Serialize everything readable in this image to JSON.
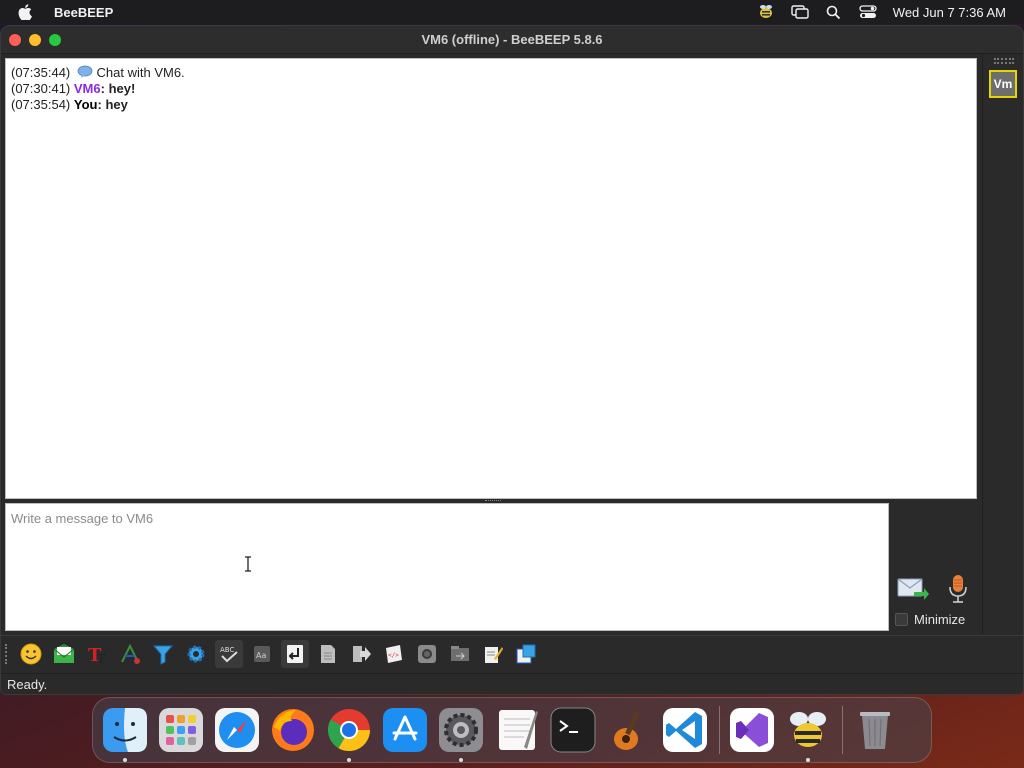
{
  "menubar": {
    "app_name": "BeeBEEP",
    "clock": "Wed Jun 7  7:36 AM",
    "icons": [
      "apple-icon",
      "beebeep-tray-icon",
      "screen-mirroring-icon",
      "spotlight-search-icon",
      "control-center-icon"
    ]
  },
  "window": {
    "title": "VM6 (offline) - BeeBEEP 5.8.6"
  },
  "chat": {
    "lines": [
      {
        "time": "(07:35:44)",
        "text": "Chat with VM6."
      },
      {
        "time": "(07:30:41)",
        "sender": "VM6",
        "sep": ": ",
        "text": "hey!"
      },
      {
        "time": "(07:35:54)",
        "sender": "You",
        "sep": ": ",
        "text": "hey"
      }
    ]
  },
  "input": {
    "placeholder": "Write a message to VM6"
  },
  "send": {
    "minimize_label": "Minimize"
  },
  "users": {
    "avatar_text": "Vm"
  },
  "toolbar": {
    "buttons": [
      "emoticon-icon",
      "mail-icon",
      "font-icon",
      "color-icon",
      "filter-icon",
      "settings-gear-icon",
      "spellcheck-icon",
      "word-completer-icon",
      "enter-key-icon",
      "save-chat-icon",
      "send-file-icon",
      "html-icon",
      "screenshot-icon",
      "share-folder-icon",
      "edit-icon",
      "detach-window-icon"
    ]
  },
  "status": {
    "text": "Ready."
  },
  "dock": {
    "apps": [
      "Finder",
      "Launchpad",
      "Safari",
      "Firefox",
      "Chrome",
      "App Store",
      "System Settings",
      "TextEdit",
      "Terminal",
      "GarageBand",
      "Visual Studio Code",
      "Visual Studio",
      "BeeBEEP",
      "Trash"
    ]
  },
  "colors": {
    "sender_vm": "#8a2be2",
    "avatar_border": "#e8d500",
    "close": "#ff5f57",
    "minimize": "#febc2e",
    "maximize": "#28c840"
  }
}
